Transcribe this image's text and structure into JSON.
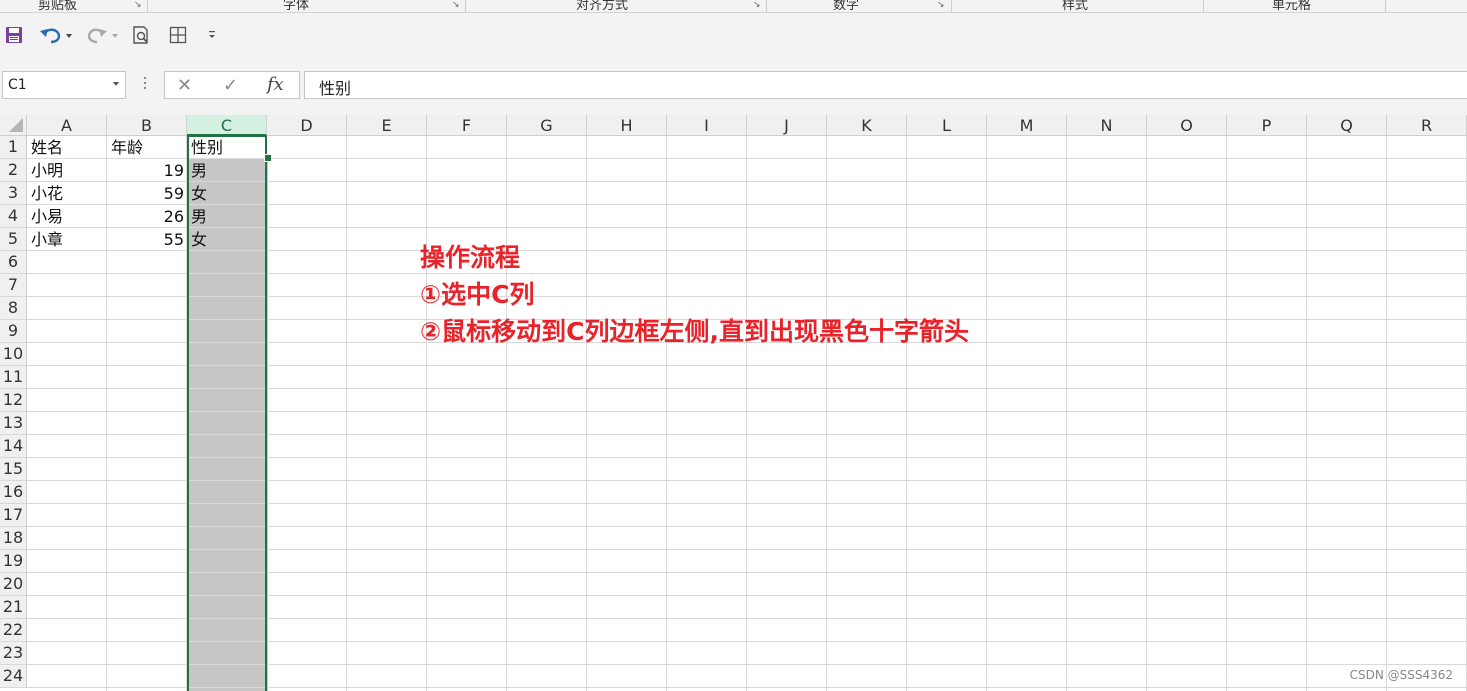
{
  "ribbon": {
    "groups": [
      {
        "label": "剪贴板"
      },
      {
        "label": "字体"
      },
      {
        "label": "对齐方式"
      },
      {
        "label": "数字"
      },
      {
        "label": "样式"
      },
      {
        "label": "单元格"
      }
    ]
  },
  "qat": {
    "icons": [
      "save-icon",
      "undo-icon",
      "redo-icon",
      "print-preview-icon",
      "borders-icon",
      "customize-qat-icon"
    ]
  },
  "formula_bar": {
    "name_box": "C1",
    "cancel_glyph": "✕",
    "enter_glyph": "✓",
    "fx_label": "fx",
    "content": "性别"
  },
  "sheet": {
    "columns": [
      "A",
      "B",
      "C",
      "D",
      "E",
      "F",
      "G",
      "H",
      "I",
      "J",
      "K",
      "L",
      "M",
      "N",
      "O",
      "P",
      "Q",
      "R"
    ],
    "selected_column": "C",
    "rows": [
      "1",
      "2",
      "3",
      "4",
      "5",
      "6",
      "7",
      "8",
      "9",
      "10",
      "11",
      "12",
      "13",
      "14",
      "15",
      "16",
      "17",
      "18",
      "19",
      "20",
      "21",
      "22",
      "23",
      "24"
    ],
    "cells": {
      "A1": "姓名",
      "B1": "年龄",
      "C1": "性别",
      "A2": "小明",
      "B2": "19",
      "C2": "男",
      "A3": "小花",
      "B3": "59",
      "C3": "女",
      "A4": "小易",
      "B4": "26",
      "C4": "男",
      "A5": "小章",
      "B5": "55",
      "C5": "女"
    },
    "selection_color": "#217346"
  },
  "annotation": {
    "title": "操作流程",
    "step1": "①选中C列",
    "step2": "②鼠标移动到C列边框左侧,直到出现黑色十字箭头",
    "color": "#e8232a"
  },
  "watermark": "CSDN @SSS4362"
}
